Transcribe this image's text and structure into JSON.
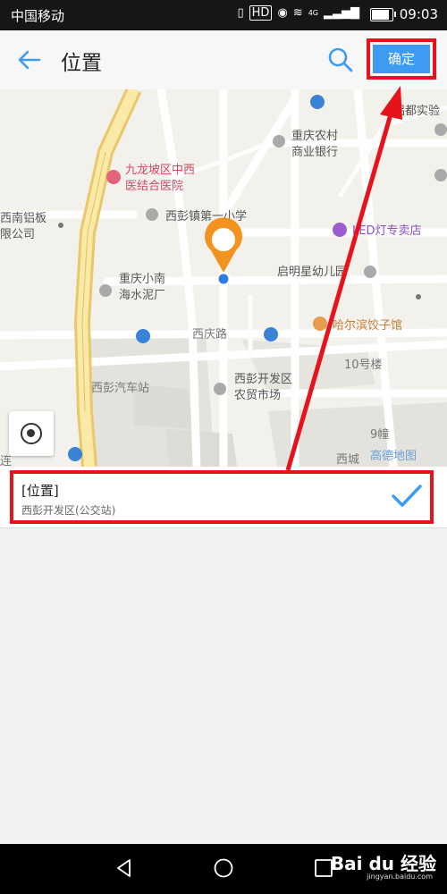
{
  "status_bar": {
    "carrier": "中国移动",
    "network": "4G",
    "hd": "HD",
    "time": "09:03"
  },
  "header": {
    "title": "位置",
    "confirm_label": "确定"
  },
  "map": {
    "labels": {
      "hospital": "九龙坡区中西",
      "hospital2": "医结合医院",
      "school": "西彭镇第一小学",
      "bank1": "重庆农村",
      "bank2": "商业银行",
      "led": "LED灯专卖店",
      "lab": "铝都实验",
      "company1": "西南铝板",
      "company2": "限公司",
      "cement1": "重庆小南",
      "cement2": "海水泥厂",
      "kinder": "启明星幼儿园",
      "road": "西庆路",
      "dumpling": "哈尔滨饺子馆",
      "b10": "10号楼",
      "bus": "西彭汽车站",
      "market1": "西彭开发区",
      "market2": "农贸市场",
      "b9": "9幢",
      "xicheng": "西城",
      "gaode": "高德地图",
      "lian": "连"
    }
  },
  "result": {
    "name": "[位置]",
    "address": "西彭开发区(公交站)"
  },
  "watermark": {
    "brand": "Bai du 经验",
    "url": "jingyan.baidu.com"
  }
}
